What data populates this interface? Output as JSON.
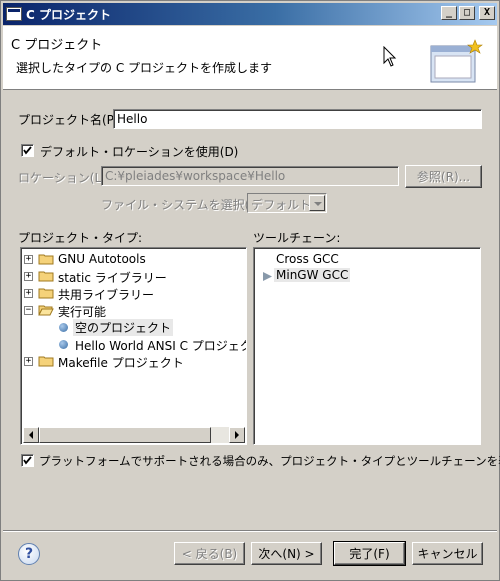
{
  "window": {
    "title": "C プロジェクト",
    "buttons": {
      "minimize": "_",
      "maximize": "□",
      "close": "X"
    }
  },
  "banner": {
    "title": "C プロジェクト",
    "description": "選択したタイプの C プロジェクトを作成します"
  },
  "form": {
    "project_name_label": "プロジェクト名(P):",
    "project_name_value": "Hello",
    "use_default_location_label": "デフォルト・ロケーションを使用(D)",
    "use_default_location_checked": true,
    "location_label": "ロケーション(L):",
    "location_value": "C:¥pleiades¥workspace¥Hello",
    "browse_button": "参照(R)...",
    "filesystem_label": "ファイル・システムを選択(Y):",
    "filesystem_value": "デフォルト"
  },
  "project_types": {
    "label": "プロジェクト・タイプ:",
    "items": [
      {
        "label": "GNU Autotools",
        "expander": "+",
        "icon": "folder-icon"
      },
      {
        "label": "static ライブラリー",
        "expander": "+",
        "icon": "folder-icon"
      },
      {
        "label": "共用ライブラリー",
        "expander": "+",
        "icon": "folder-icon"
      },
      {
        "label": "実行可能",
        "expander": "−",
        "icon": "open-folder-icon"
      },
      {
        "label": "空のプロジェクト",
        "icon": "project-dot-icon",
        "selected": true
      },
      {
        "label": "Hello World ANSI C プロジェクト",
        "icon": "project-dot-icon"
      },
      {
        "label": "Makefile プロジェクト",
        "expander": "+",
        "icon": "folder-icon"
      }
    ]
  },
  "toolchains": {
    "label": "ツールチェーン:",
    "items": [
      {
        "label": "Cross GCC"
      },
      {
        "label": "MinGW GCC",
        "selected": true
      }
    ]
  },
  "platform_filter": {
    "label": "プラットフォームでサポートされる場合のみ、プロジェクト・タイプとツールチェーンを表示",
    "checked": true
  },
  "footer": {
    "help": "?",
    "back_button": "< 戻る(B)",
    "next_button": "次へ(N) >",
    "finish_button": "完了(F)",
    "cancel_button": "キャンセル"
  },
  "colors": {
    "titlebar_start": "#0a246a",
    "titlebar_end": "#a6caf0",
    "dialog_bg": "#d4d0c8",
    "selection": "#e8e8e8"
  }
}
